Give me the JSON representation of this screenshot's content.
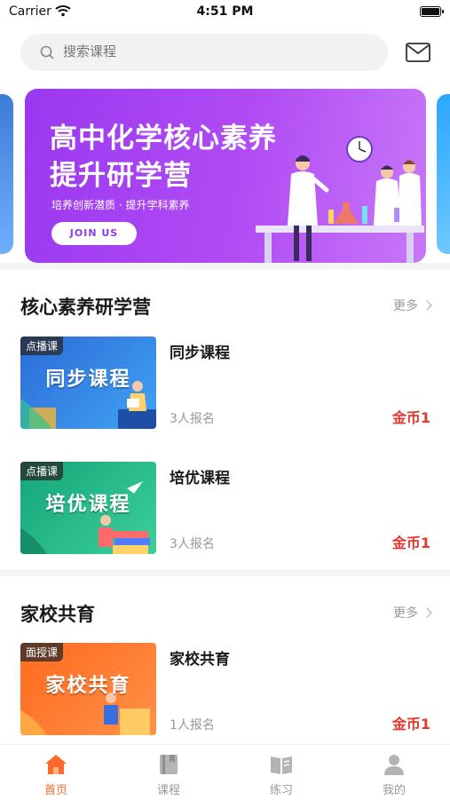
{
  "status_bar": {
    "carrier": "Carrier",
    "time": "4:51 PM"
  },
  "search": {
    "placeholder": "搜索课程"
  },
  "banner": {
    "title_line1": "高中化学核心素养",
    "title_line2": "提升研学营",
    "subtitle": "培养创新潜质 · 提升学科素养",
    "button": "JOIN US"
  },
  "sections": [
    {
      "title": "核心素养研学营",
      "more": "更多",
      "courses": [
        {
          "tag": "点播课",
          "thumb_title": "同步课程",
          "name": "同步课程",
          "enrolled": "3人报名",
          "price": "金币1"
        },
        {
          "tag": "点播课",
          "thumb_title": "培优课程",
          "name": "培优课程",
          "enrolled": "3人报名",
          "price": "金币1"
        }
      ]
    },
    {
      "title": "家校共育",
      "more": "更多",
      "courses": [
        {
          "tag": "面授课",
          "thumb_title": "家校共育",
          "name": "家校共育",
          "enrolled": "1人报名",
          "price": "金币1"
        }
      ]
    }
  ],
  "tabbar": [
    {
      "label": "首页",
      "icon": "home-icon",
      "active": true
    },
    {
      "label": "课程",
      "icon": "course-book-icon",
      "active": false
    },
    {
      "label": "练习",
      "icon": "practice-book-icon",
      "active": false
    },
    {
      "label": "我的",
      "icon": "profile-icon",
      "active": false
    }
  ],
  "colors": {
    "accent": "#ff6a2a",
    "price": "#e8352c",
    "banner": "#a542f2"
  }
}
